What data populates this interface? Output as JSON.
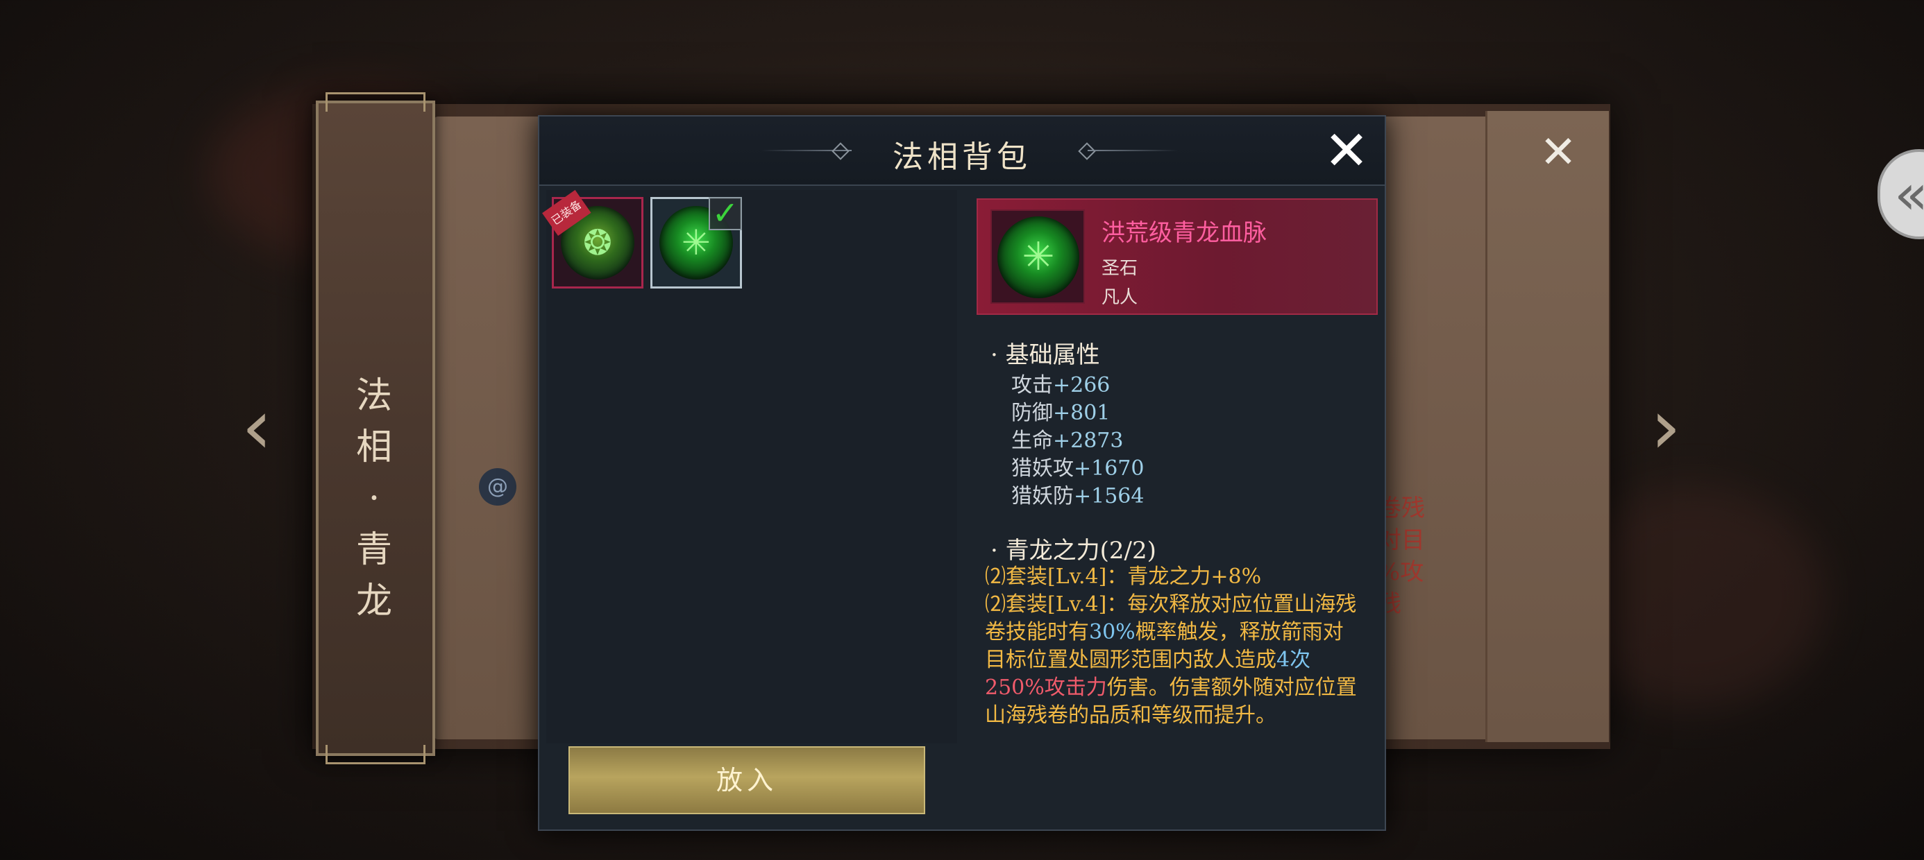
{
  "background": {
    "scroll_title_chars": [
      "法",
      "相",
      "·",
      "青",
      "龙"
    ],
    "partial_text_lines": [
      "卷残",
      "对目",
      "%攻",
      "残"
    ],
    "close_icon": "close-icon",
    "left_arrow_icon": "chevron-left-icon",
    "right_arrow_icon": "chevron-right-icon",
    "side_tab_icon": "double-chevron-left-icon",
    "seal_icon": "swirl-seal-icon"
  },
  "modal": {
    "title": "法相背包",
    "close_icon": "close-icon",
    "inventory": {
      "slots": [
        {
          "badge": "已装备",
          "icon": "green-orb-icon",
          "selected": false
        },
        {
          "badge": "",
          "icon": "green-orb-icon",
          "selected": true
        }
      ],
      "put_button": "放入"
    },
    "detail": {
      "name": "洪荒级青龙血脉",
      "type": "圣石",
      "rank": "凡人",
      "base_section": "· 基础属性",
      "base_stats": [
        {
          "label": "攻击",
          "value": "+266"
        },
        {
          "label": "防御",
          "value": "+801"
        },
        {
          "label": "生命",
          "value": "+2873"
        },
        {
          "label": "猎妖攻",
          "value": "+1670"
        },
        {
          "label": "猎妖防",
          "value": "+1564"
        }
      ],
      "set_section": "· 青龙之力(2/2)",
      "set_line_1": "⑵套装[Lv.4]：青龙之力+8%",
      "set_line_2_a": "⑵套装[Lv.4]：每次释放对应位置山海残卷技能时有",
      "set_line_2_b": "30%",
      "set_line_2_c": "概率触发，释放箭雨对目标位置处圆形范围内敌人造成",
      "set_line_2_d": "4次",
      "set_line_2_e": "250%攻击力",
      "set_line_2_f": "伤害。伤害额外随对应位置山海残卷的品质和等级而提升。"
    },
    "colors": {
      "rarity_name": "#ff5ea0",
      "set_text": "#f2b944",
      "highlight_blue": "#7fc6f0",
      "highlight_red": "#f05b6b",
      "button_gold": "#b8a45e"
    }
  }
}
